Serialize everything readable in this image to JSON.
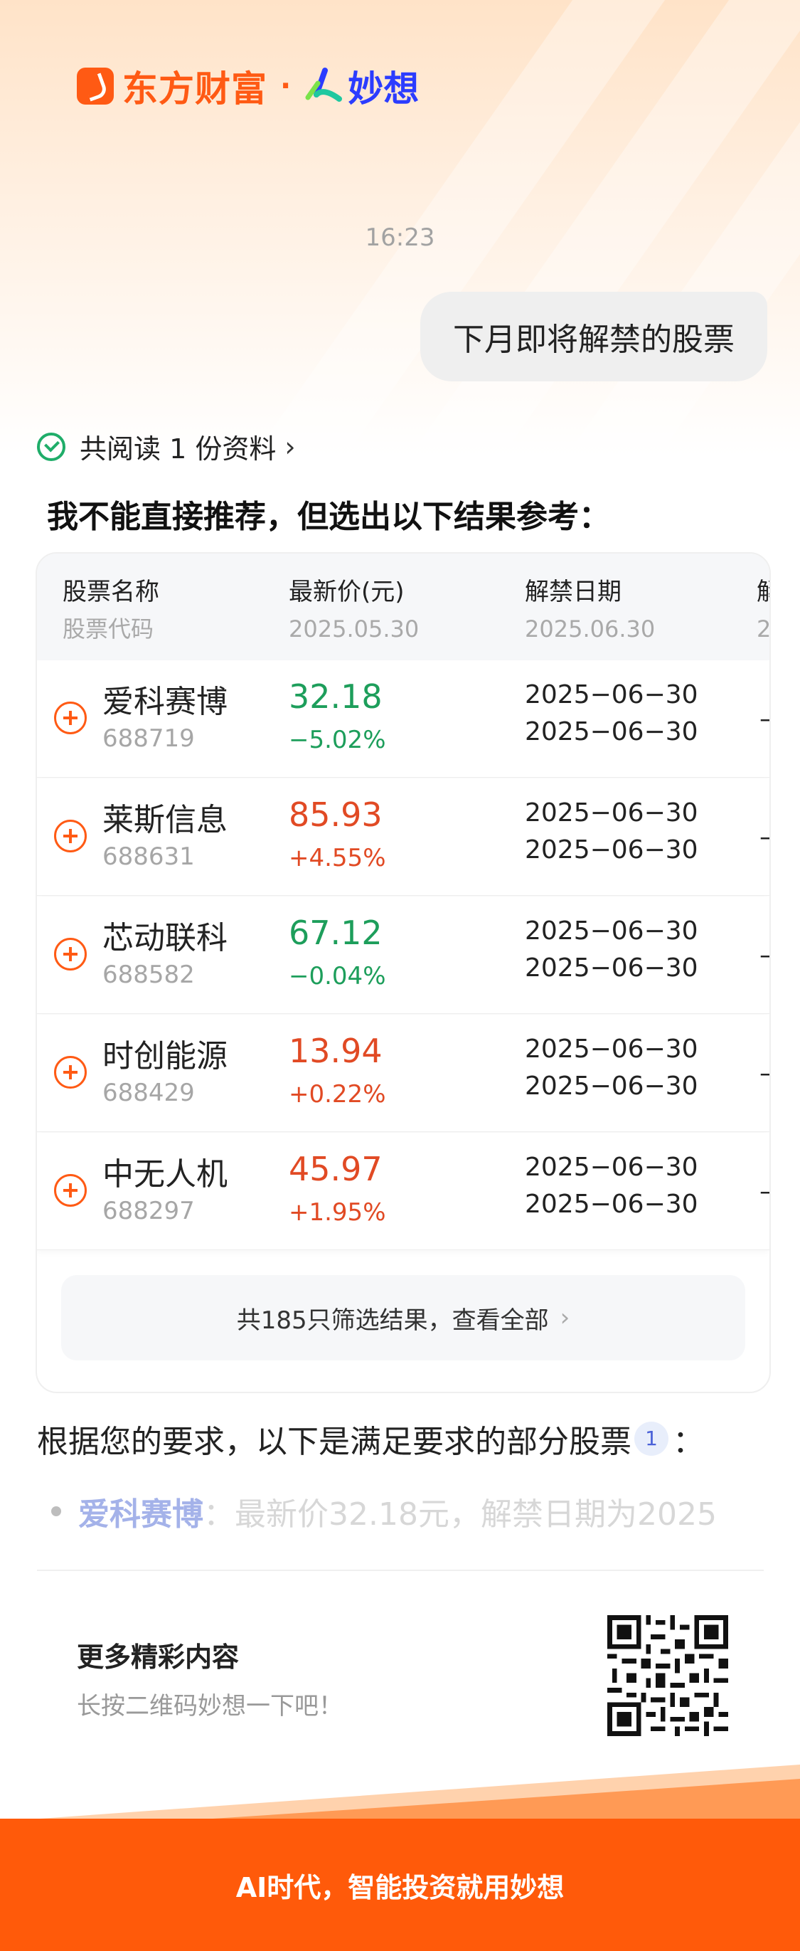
{
  "brand": {
    "name": "东方财富",
    "dot": "·",
    "product": "妙想"
  },
  "chat": {
    "time": "16:23",
    "user_message": "下月即将解禁的股票",
    "read_info": "共阅读 1 份资料",
    "answer_title": "我不能直接推荐，但选出以下结果参考："
  },
  "table": {
    "headers": [
      {
        "label": "股票名称",
        "sub": "股票代码"
      },
      {
        "label": "最新价(元)",
        "sub": "2025.05.30"
      },
      {
        "label": "解禁日期",
        "sub": "2025.06.30"
      },
      {
        "label": "解",
        "sub": "2"
      }
    ],
    "rows": [
      {
        "name": "爱科赛博",
        "code": "688719",
        "price": "32.18",
        "pct": "−5.02%",
        "trend": "down",
        "date1": "2025−06−30",
        "date2": "2025−06−30",
        "extra": "–"
      },
      {
        "name": "莱斯信息",
        "code": "688631",
        "price": "85.93",
        "pct": "+4.55%",
        "trend": "up",
        "date1": "2025−06−30",
        "date2": "2025−06−30",
        "extra": "–"
      },
      {
        "name": "芯动联科",
        "code": "688582",
        "price": "67.12",
        "pct": "−0.04%",
        "trend": "down",
        "date1": "2025−06−30",
        "date2": "2025−06−30",
        "extra": "–"
      },
      {
        "name": "时创能源",
        "code": "688429",
        "price": "13.94",
        "pct": "+0.22%",
        "trend": "up",
        "date1": "2025−06−30",
        "date2": "2025−06−30",
        "extra": "–"
      },
      {
        "name": "中无人机",
        "code": "688297",
        "price": "45.97",
        "pct": "+1.95%",
        "trend": "up",
        "date1": "2025−06−30",
        "date2": "2025−06−30",
        "extra": "–"
      }
    ],
    "view_all": "共185只筛选结果，查看全部",
    "view_all_arrow": "›"
  },
  "summary": {
    "text": "根据您的要求，以下是满足要求的部分股票",
    "cite": "1",
    "colon": "：",
    "fade_stock": "爱科赛博",
    "fade_text": "：最新价32.18元，解禁日期为2025"
  },
  "promo": {
    "title": "更多精彩内容",
    "subtitle": "长按二维码妙想一下吧！"
  },
  "footer": {
    "text": "AI时代，智能投资就用妙想"
  },
  "colors": {
    "accent": "#ff5a14",
    "up": "#e14a24",
    "down": "#1d9e5b",
    "footer": "#ff5a0a"
  }
}
